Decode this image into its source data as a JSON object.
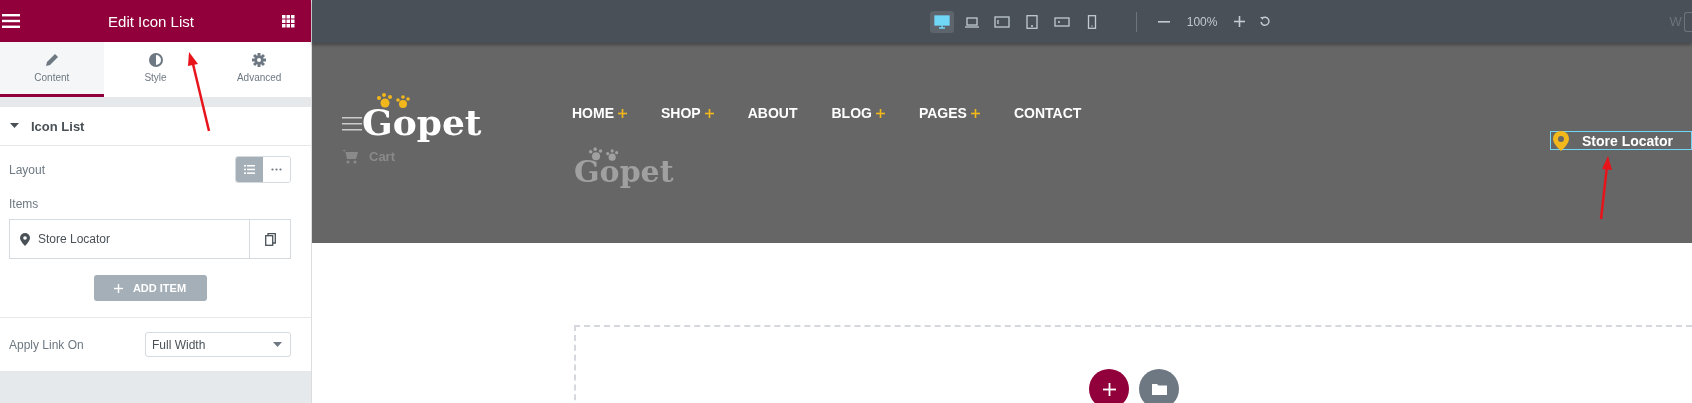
{
  "panel": {
    "title": "Edit Icon List",
    "tabs": [
      {
        "label": "Content",
        "kind": "pencil",
        "selected": true
      },
      {
        "label": "Style",
        "kind": "contrast",
        "selected": false
      },
      {
        "label": "Advanced",
        "kind": "gear",
        "selected": false
      }
    ],
    "section": {
      "title": "Icon List",
      "expanded": true
    },
    "layout": {
      "label": "Layout",
      "options": [
        {
          "kind": "list",
          "selected": true
        },
        {
          "kind": "inline",
          "selected": false
        }
      ]
    },
    "items_label": "Items",
    "items": [
      {
        "label": "Store Locator"
      }
    ],
    "add_button": "ADD ITEM",
    "apply_link": {
      "label": "Apply Link On",
      "value": "Full Width"
    }
  },
  "toolbar": {
    "devices": [
      {
        "kind": "desktop",
        "selected": true
      },
      {
        "kind": "laptop",
        "selected": false
      },
      {
        "kind": "tablet-landscape",
        "selected": false
      },
      {
        "kind": "tablet",
        "selected": false
      },
      {
        "kind": "mobile-landscape",
        "selected": false
      },
      {
        "kind": "mobile",
        "selected": false
      }
    ],
    "zoom": "100%",
    "width_label": "W"
  },
  "site": {
    "logo": "Gopet",
    "nav": [
      {
        "label": "HOME",
        "submenu": true
      },
      {
        "label": "SHOP",
        "submenu": true
      },
      {
        "label": "ABOUT",
        "submenu": false
      },
      {
        "label": "BLOG",
        "submenu": true
      },
      {
        "label": "PAGES",
        "submenu": true
      },
      {
        "label": "CONTACT",
        "submenu": false
      }
    ],
    "cart": "Cart",
    "logo_copy": "Gopet",
    "store_locator": "Store Locator"
  }
}
